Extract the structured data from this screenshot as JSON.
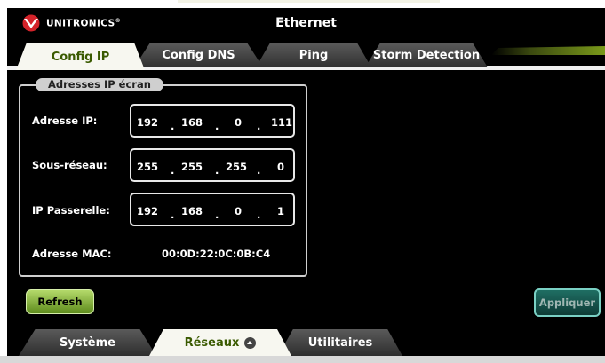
{
  "header": {
    "brand": "UNITRONICS",
    "title": "Ethernet"
  },
  "tabs": [
    {
      "label": "Config IP",
      "active": true
    },
    {
      "label": "Config DNS",
      "active": false
    },
    {
      "label": "Ping",
      "active": false
    },
    {
      "label": "Storm Detection",
      "active": false
    }
  ],
  "group": {
    "legend": "Adresses IP écran",
    "ip_label": "Adresse IP:",
    "ip": [
      "192",
      "168",
      "0",
      "111"
    ],
    "subnet_label": "Sous-réseau:",
    "subnet": [
      "255",
      "255",
      "255",
      "0"
    ],
    "gateway_label": "IP Passerelle:",
    "gateway": [
      "192",
      "168",
      "0",
      "1"
    ],
    "mac_label": "Adresse MAC:",
    "mac": "00:0D:22:0C:0B:C4"
  },
  "buttons": {
    "refresh": "Refresh",
    "apply": "Appliquer"
  },
  "bottom_tabs": [
    {
      "label": "Système",
      "active": false
    },
    {
      "label": "Réseaux",
      "active": true
    },
    {
      "label": "Utilitaires",
      "active": false
    }
  ],
  "colors": {
    "accent_green": "#7a9a1a",
    "apply_teal": "#1f6e63",
    "background": "#000000"
  }
}
